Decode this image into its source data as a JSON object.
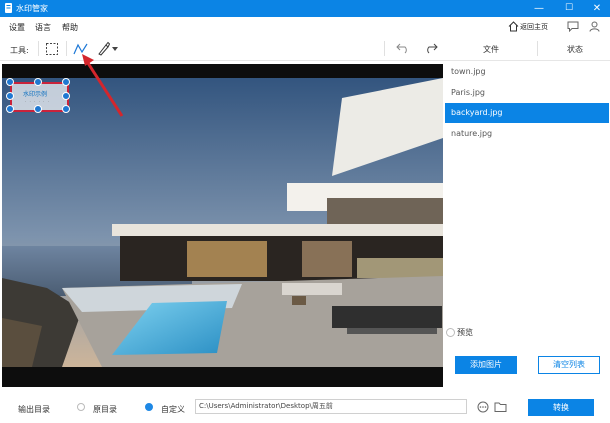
{
  "window": {
    "title": "水印管家",
    "minimize": "—",
    "maximize": "☐",
    "close": "✕"
  },
  "menu": [
    {
      "label": "设置"
    },
    {
      "label": "语言"
    },
    {
      "label": "帮助"
    }
  ],
  "header_right": {
    "home_label": "返回主页"
  },
  "toolbar": {
    "label": "工具:",
    "files_header": "文件",
    "status_header": "状态"
  },
  "watermark": {
    "title": "水印示例",
    "subtitle": "· · · · · ·"
  },
  "files": [
    {
      "name": "town.jpg",
      "selected": false
    },
    {
      "name": "Paris.jpg",
      "selected": false
    },
    {
      "name": "backyard.jpg",
      "selected": true
    },
    {
      "name": "nature.jpg",
      "selected": false
    }
  ],
  "preview": {
    "label": "预览"
  },
  "buttons": {
    "add_image": "添加图片",
    "clear_list": "清空列表",
    "convert": "转换"
  },
  "output": {
    "label": "输出目录",
    "option_original": "原目录",
    "option_custom": "自定义",
    "path_value": "C:\\Users\\Administrator\\Desktop\\周五前"
  },
  "colors": {
    "accent": "#0b84e5",
    "watermark_border": "#c9233b",
    "annotation_arrow": "#d4262c"
  }
}
